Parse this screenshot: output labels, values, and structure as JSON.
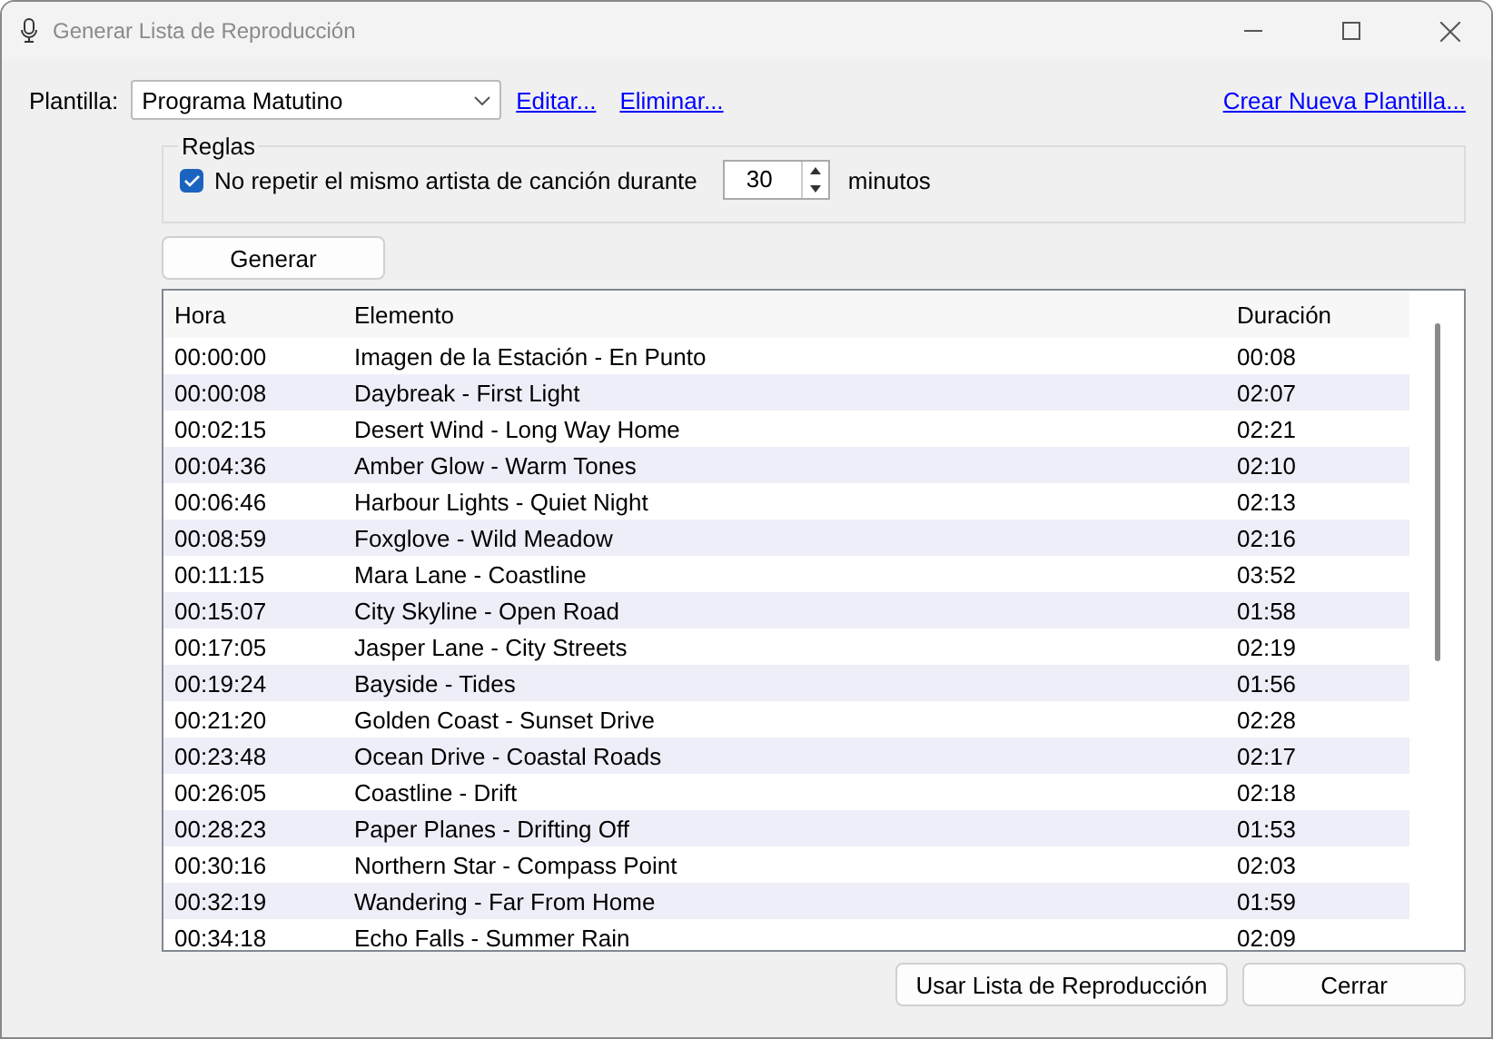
{
  "window": {
    "title": "Generar Lista de Reproducción"
  },
  "template": {
    "label": "Plantilla:",
    "value": "Programa Matutino",
    "links": [
      "Editar...",
      "Eliminar..."
    ],
    "create_link": "Crear Nueva Plantilla..."
  },
  "rules": {
    "title": "Reglas",
    "checkbox": {
      "label": "No repetir el mismo artista de canción durante",
      "checked": true
    },
    "spin_value": "30",
    "unit": "minutos"
  },
  "generate_button": "Generar",
  "table": {
    "columns": [
      "Hora",
      "Elemento",
      "Duración"
    ],
    "rows": [
      [
        "00:00:00",
        "Imagen de la Estación - En Punto",
        "00:08"
      ],
      [
        "00:00:08",
        "Daybreak - First Light",
        "02:07"
      ],
      [
        "00:02:15",
        "Desert Wind - Long Way Home",
        "02:21"
      ],
      [
        "00:04:36",
        "Amber Glow - Warm Tones",
        "02:10"
      ],
      [
        "00:06:46",
        "Harbour Lights - Quiet Night",
        "02:13"
      ],
      [
        "00:08:59",
        "Foxglove - Wild Meadow",
        "02:16"
      ],
      [
        "00:11:15",
        "Mara Lane - Coastline",
        "03:52"
      ],
      [
        "00:15:07",
        "City Skyline - Open Road",
        "01:58"
      ],
      [
        "00:17:05",
        "Jasper Lane - City Streets",
        "02:19"
      ],
      [
        "00:19:24",
        "Bayside - Tides",
        "01:56"
      ],
      [
        "00:21:20",
        "Golden Coast - Sunset Drive",
        "02:28"
      ],
      [
        "00:23:48",
        "Ocean Drive - Coastal Roads",
        "02:17"
      ],
      [
        "00:26:05",
        "Coastline - Drift",
        "02:18"
      ],
      [
        "00:28:23",
        "Paper Planes - Drifting Off",
        "01:53"
      ],
      [
        "00:30:16",
        "Northern Star - Compass Point",
        "02:03"
      ],
      [
        "00:32:19",
        "Wandering - Far From Home",
        "01:59"
      ],
      [
        "00:34:18",
        "Echo Falls - Summer Rain",
        "02:09"
      ]
    ]
  },
  "buttons": [
    "Usar Lista de Reproducción",
    "Cerrar"
  ]
}
